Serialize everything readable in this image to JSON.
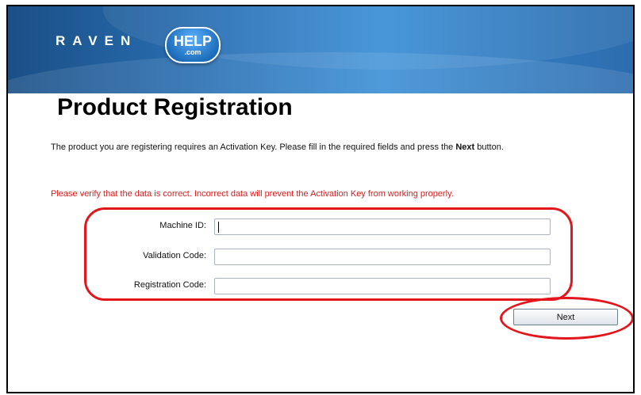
{
  "header": {
    "brand": "RAVEN",
    "badge_main": "HELP",
    "badge_sub": ".com"
  },
  "page": {
    "title": "Product Registration",
    "intro_before": "The product you are registering requires an Activation Key. Please fill in the required fields and press the ",
    "intro_bold": "Next",
    "intro_after": " button.",
    "warning": "Please verify that the data is correct. Incorrect data will prevent the Activation Key from working properly."
  },
  "form": {
    "machine_id_label": "Machine ID:",
    "machine_id_value": "",
    "validation_code_label": "Validation Code:",
    "validation_code_value": "",
    "registration_code_label": "Registration Code:",
    "registration_code_value": "",
    "next_label": "Next"
  },
  "colors": {
    "header_blue": "#2b73b8",
    "warning_red": "#e01b1b",
    "highlight_red": "#e3161b"
  }
}
